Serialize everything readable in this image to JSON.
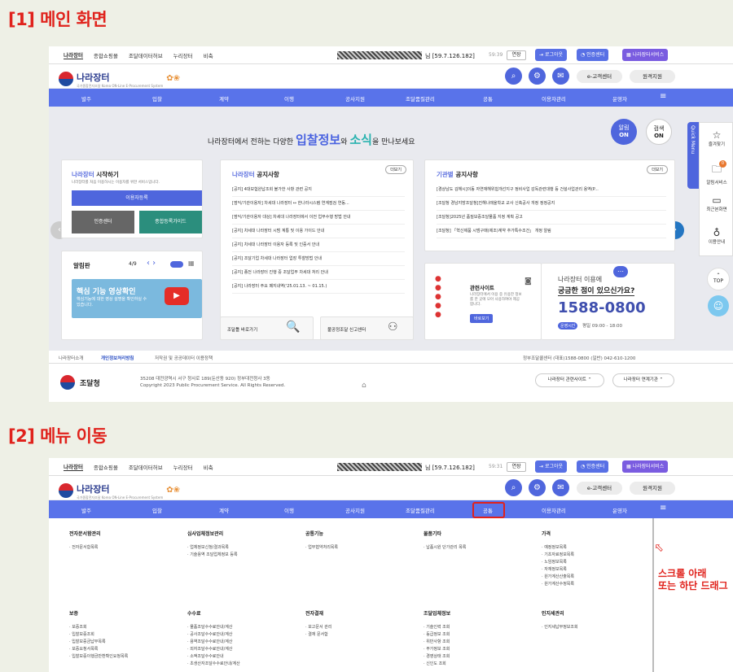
{
  "captions": {
    "c1": "[1] 메인 화면",
    "c2": "[2] 메뉴 이동"
  },
  "topbar": {
    "links": [
      "나라장터",
      "종합쇼핑몰",
      "조달데이터허브",
      "누리장터",
      "비축"
    ],
    "user": "님 [59.7.126.182]",
    "timer1": "59:39",
    "timer2": "59:31",
    "extend": "연장",
    "logout": "로그아웃",
    "cert": "인증센터",
    "services": "나라장터서비스"
  },
  "logo": {
    "name": "나라장터",
    "sub": "국가종합전자조달 Korea ON-Line E-Procurement System"
  },
  "header": {
    "ecustomer": "e-고객센터",
    "remote": "원격지원"
  },
  "nav": [
    "발주",
    "입찰",
    "계약",
    "이행",
    "공사지원",
    "조달품질관리",
    "공통",
    "이용자관리",
    "운영자"
  ],
  "hero": {
    "pre": "나라장터에서 전하는 다양한",
    "hl1": "입찰정보",
    "mid": "와",
    "hl2": "소식",
    "post": "을 만나보세요",
    "alert_on": "알림",
    "alert_on2": "ON",
    "search_on": "검색",
    "search_on2": "ON"
  },
  "start": {
    "title_b": "나라장터",
    "title": "시작하기",
    "desc": "나라장터를 처음 이용하시는 이용자를 위한 서비스입니다.",
    "reg": "이용자등록",
    "cert": "인증센터",
    "guide": "종합등록가이드"
  },
  "notice_board": {
    "label": "알림판",
    "page": "4/9",
    "video": "핵심 기능 영상확인",
    "video_sub": "핵심기능에 대한 영상 설명을 확인하실 수 있습니다."
  },
  "notice": {
    "title_b": "나라장터",
    "title": "공지사항",
    "more": "더보기",
    "items": [
      "[공지] 4대보험완납조회 불가한 사항 관련 공지",
      "[점익/기관이용자] 차세대 나라장터 ↔ 한나라시스템 연계점검 연동...",
      "[점익/기관이용자 대상] 차세대 나라장터에서 이전 업무수행 방법 안내",
      "[공지] 차세대 나라장터 시범 계통 및 이용 가이드 안내",
      "[공지] 차세대 나라장터 이용자 등록 및 인증서 안내",
      "[공지] 조달기업 차세대 나라장터 업장 투찰방법 안내",
      "[공지] 종전 나라장터 진행 중 조달업무 차세대 처리 안내",
      "[공지] 나라장터 주요 페지내역('25.01.13. ~ 01.15.)"
    ]
  },
  "agency": {
    "title_b": "기관별",
    "title": "공지사항",
    "more": "더보기",
    "items": [
      "[경상남도 김해시]이동 자연재해위험개선지구 정비사업 감독관련대행 등 건설사업관리 용역(P...",
      "[조달청 경남지방조달청]진해나래울학교 교사 신축공사 개정 정정공지",
      "[조달청]2025년 품질보증조달물품 지정 계획 공고",
      "[조달청] 「혁신제품 시범구매(제조)계약 추가특수조건」 개정 알림"
    ]
  },
  "links": {
    "barrier": "조달틀 바로가기",
    "report": "불공정조달 신고센터"
  },
  "related": {
    "title": "관련사이트",
    "desc": "나라장터에서 이용 중 유용한 정보를 한 곳에 모아 사용하여야 제공합니다.",
    "btn": "바로보기"
  },
  "help": {
    "q1": "나라장터 이용에",
    "q2": "궁금한 점이 있으신가요?",
    "phone": "1588-0800",
    "hours_label": "운영시간",
    "hours": "평일 09:00 - 18:00"
  },
  "sidebar": {
    "quick": "Quick Menu",
    "fav": "즐겨찾기",
    "alarm": "알림서비스",
    "alarm_count": "0",
    "recent": "최근본화면",
    "guide": "이용안내",
    "top": "TOP"
  },
  "footer": {
    "links": [
      "나라장터소개",
      "개인정보처리방침",
      "저작권 및 공공데이터 이용정책"
    ],
    "right": "정부조달콜센터 (대표)1588-0800 (일반) 042-610-1200",
    "org": "조달청",
    "addr": "35208 대전광역시 서구 청사로 189(둔산동 920) 정부대전청사 3동",
    "copy": "Copyright 2023 Public Procurement Service. All Rights Reserved.",
    "rel1": "나라장터 관련사이트",
    "rel2": "나라장터 연계기관"
  },
  "menu": {
    "cols": [
      {
        "h": "전자문서함관리",
        "items": [
          "전자문서함목록"
        ]
      },
      {
        "h": "심사업체정보관리",
        "items": [
          "업체정보신청/결과목록",
          "기술용역 조달업체정보 등록"
        ]
      },
      {
        "h": "공통기능",
        "items": [
          "업무협약처리목록"
        ]
      },
      {
        "h": "물품기타",
        "items": [
          "납품시원 단가관리 목록"
        ]
      },
      {
        "h": "가격",
        "items": [
          "예정정보목록",
          "기초자료정보목록",
          "노임정보목록",
          "자재정보목록",
          "원가계산산출목록",
          "원가계산수정목록"
        ]
      },
      {
        "h": "보증",
        "items": [
          "보증조회",
          "입찰보증조회",
          "입찰보증금납부목록",
          "보증요청서목록",
          "입찰보증이행금반환확인요청목록"
        ]
      },
      {
        "h": "수수료",
        "items": [
          "물품조달수수료안내/계산",
          "공사조달수수료안내/계산",
          "용역조달수수료안내/계산",
          "외자조달수수료안내/계산",
          "소액조달수수료안내",
          "초생산자조달수수료안내/계산"
        ]
      },
      {
        "h": "전자결재",
        "items": [
          "보고문서 관리",
          "결재 문서함"
        ]
      },
      {
        "h": "조달업체정보",
        "items": [
          "기술인력 조회",
          "등급정보 조회",
          "위반사항 조회",
          "부가정보 조회",
          "경영상태 조회",
          "신인도 조회"
        ]
      },
      {
        "h": "인지세관리",
        "items": [
          "인지세납부정보조회"
        ]
      }
    ]
  },
  "annotation": {
    "l1": "스크롤 아래",
    "l2": "또는 하단 드래그"
  }
}
